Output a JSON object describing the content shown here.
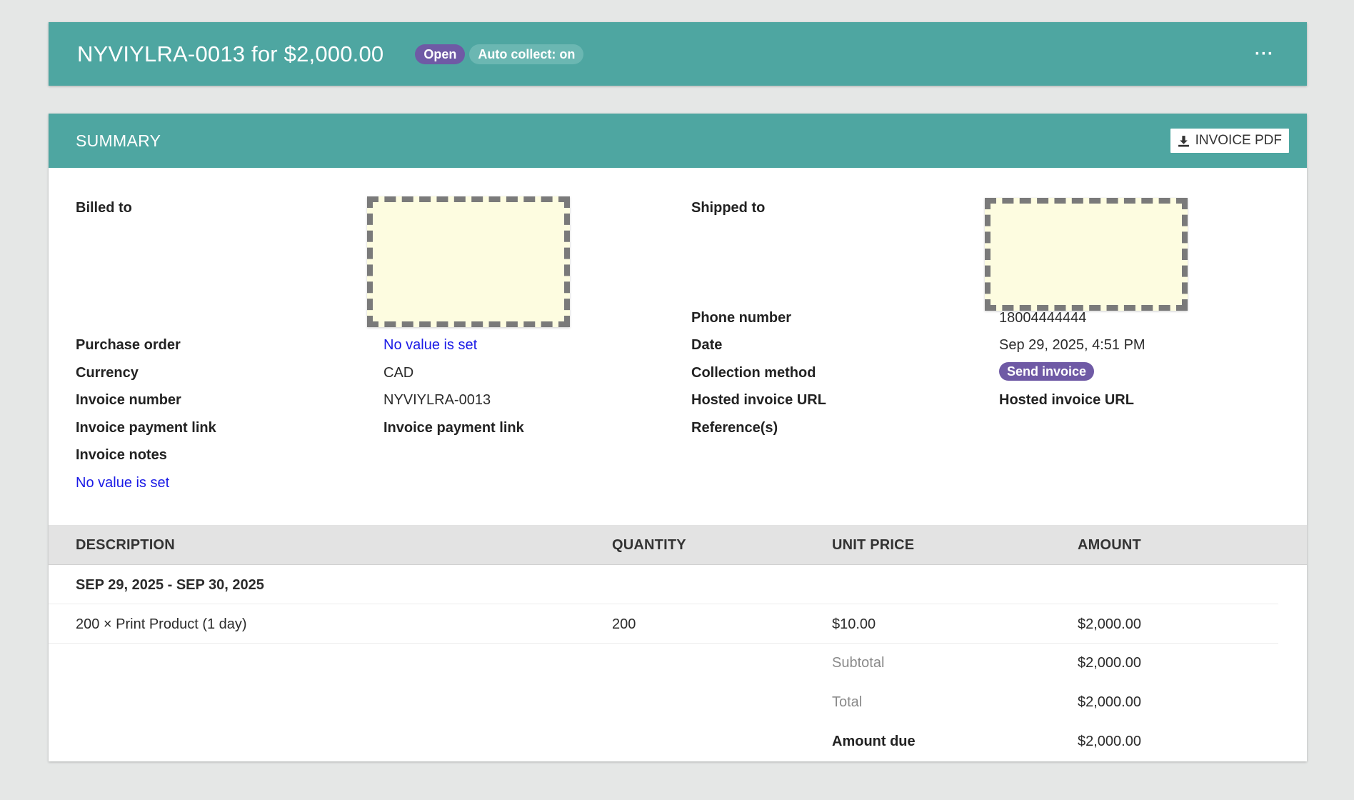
{
  "header": {
    "title": "NYVIYLRA-0013 for $2,000.00",
    "status_badge": "Open",
    "auto_collect_badge": "Auto collect: on",
    "more_label": "···"
  },
  "summary": {
    "title": "SUMMARY",
    "pdf_button": "INVOICE PDF",
    "fields": {
      "billed_to_label": "Billed to",
      "shipped_to_label": "Shipped to",
      "phone_label": "Phone number",
      "phone_value": "18004444444",
      "purchase_order_label": "Purchase order",
      "purchase_order_value": "No value is set",
      "date_label": "Date",
      "date_value": "Sep 29, 2025, 4:51 PM",
      "currency_label": "Currency",
      "currency_value": "CAD",
      "collection_method_label": "Collection method",
      "collection_method_value": "Send invoice",
      "invoice_number_label": "Invoice number",
      "invoice_number_value": "NYVIYLRA-0013",
      "hosted_url_label": "Hosted invoice URL",
      "hosted_url_value": "Hosted invoice URL",
      "payment_link_label": "Invoice payment link",
      "payment_link_value": "Invoice payment link",
      "references_label": "Reference(s)",
      "notes_label": "Invoice notes",
      "notes_value": "No value is set"
    }
  },
  "table": {
    "headers": [
      "DESCRIPTION",
      "QUANTITY",
      "UNIT PRICE",
      "AMOUNT"
    ],
    "period": "SEP 29, 2025 - SEP 30, 2025",
    "line_items": [
      {
        "description": "200 × Print Product (1 day)",
        "quantity": "200",
        "unit_price": "$10.00",
        "amount": "$2,000.00"
      }
    ],
    "subtotal_label": "Subtotal",
    "subtotal_value": "$2,000.00",
    "total_label": "Total",
    "total_value": "$2,000.00",
    "amount_due_label": "Amount due",
    "amount_due_value": "$2,000.00"
  },
  "colors": {
    "header_bg": "#4ea6a1",
    "badge_purple": "#6f5aa5",
    "link_blue": "#1a1ae6",
    "placeholder_fill": "#fdfce0"
  }
}
